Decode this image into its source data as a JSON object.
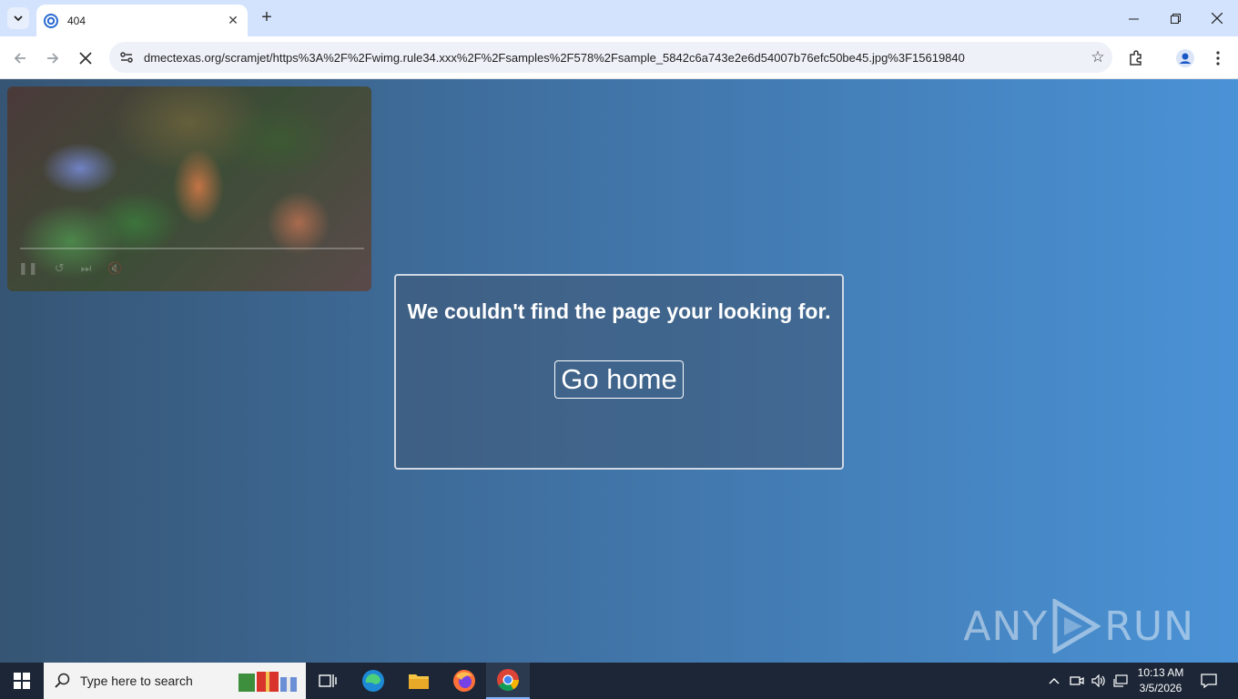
{
  "browser": {
    "tab_title": "404",
    "url": "dmectexas.org/scramjet/https%3A%2F%2Fwimg.rule34.xxx%2F%2Fsamples%2F578%2Fsample_5842c6a743e2e6d54007b76efc50be45.jpg%3F15619840"
  },
  "page": {
    "heading": "We couldn't find the page your looking for.",
    "button_label": "Go home"
  },
  "watermark": {
    "left": "ANY",
    "right": "RUN"
  },
  "taskbar": {
    "search_placeholder": "Type here to search",
    "time": "10:13 AM",
    "date": "3/5/2026"
  },
  "colors": {
    "page_gradient_start": "#365574",
    "page_gradient_end": "#4a92d6",
    "tabstrip": "#d3e3fd",
    "taskbar": "#1c2636"
  }
}
